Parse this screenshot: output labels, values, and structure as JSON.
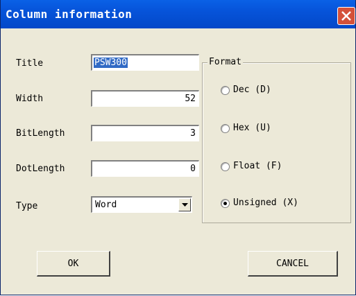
{
  "window": {
    "title": "Column information",
    "close_icon": "close-icon"
  },
  "fields": {
    "title_label": "Title",
    "title_value": "PSW300",
    "width_label": "Width",
    "width_value": "52",
    "bitlength_label": "BitLength",
    "bitlength_value": "3",
    "dotlength_label": "DotLength",
    "dotlength_value": "0",
    "type_label": "Type",
    "type_value": "Word"
  },
  "format": {
    "legend": "Format",
    "options": [
      {
        "label": "Dec (D)",
        "selected": false
      },
      {
        "label": "Hex (U)",
        "selected": false
      },
      {
        "label": "Float (F)",
        "selected": false
      },
      {
        "label": "Unsigned (X)",
        "selected": true
      }
    ]
  },
  "buttons": {
    "ok": "OK",
    "cancel": "CANCEL"
  },
  "colors": {
    "titlebar": "#0653d9",
    "dialog_bg": "#ece9d8",
    "close": "#d4513a",
    "selection": "#316ac5"
  }
}
